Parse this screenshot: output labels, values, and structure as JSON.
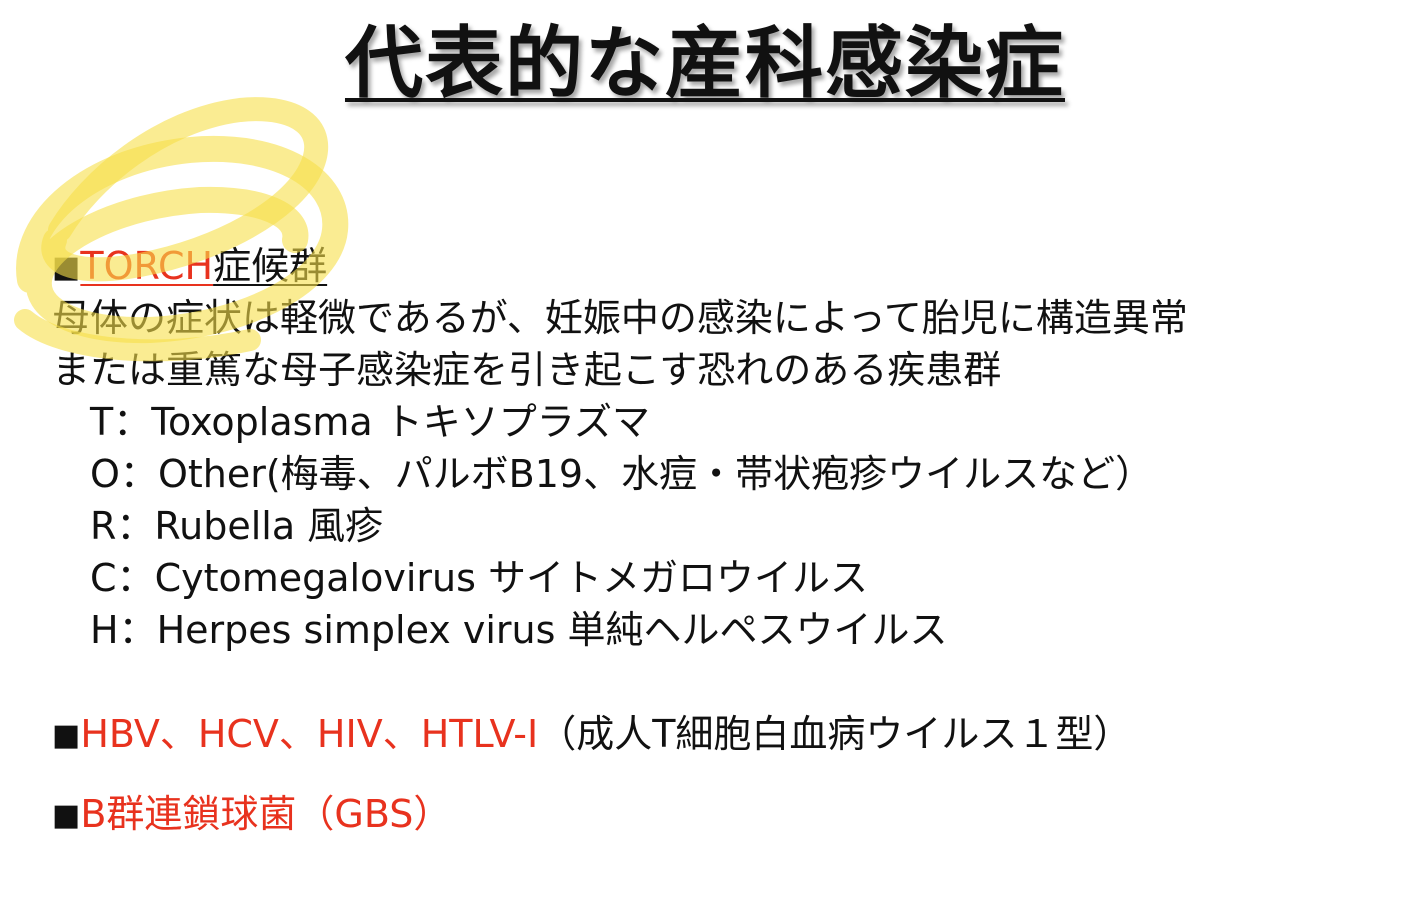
{
  "title": "代表的な産科感染症",
  "torch": {
    "bullet": "■",
    "heading_red": "TORCH",
    "heading_rest": "症候群",
    "desc_line1": "母体の症状は軽微であるが、妊娠中の感染によって胎児に構造異常",
    "desc_line2": "または重篤な母子感染症を引き起こす恐れのある疾患群",
    "items": [
      {
        "letter": "T",
        "text": "Toxoplasma トキソプラズマ"
      },
      {
        "letter": "O",
        "text": "Other(梅毒、パルボB19、水痘・帯状疱疹ウイルスなど）"
      },
      {
        "letter": "R",
        "text": "Rubella 風疹"
      },
      {
        "letter": "C",
        "text": "Cytomegalovirus サイトメガロウイルス"
      },
      {
        "letter": "H",
        "text": "Herpes simplex virus 単純ヘルペスウイルス"
      }
    ],
    "separator": "："
  },
  "viruses": {
    "bullet": "■",
    "names": "HBV、HCV、HIV、HTLV-I",
    "note": "（成人T細胞白血病ウイルス１型）"
  },
  "gbs": {
    "bullet": "■",
    "label": "B群連鎖球菌（GBS）"
  },
  "colors": {
    "accent_red": "#e8321e",
    "highlight_yellow": "#f6e04a",
    "text": "#111111"
  }
}
